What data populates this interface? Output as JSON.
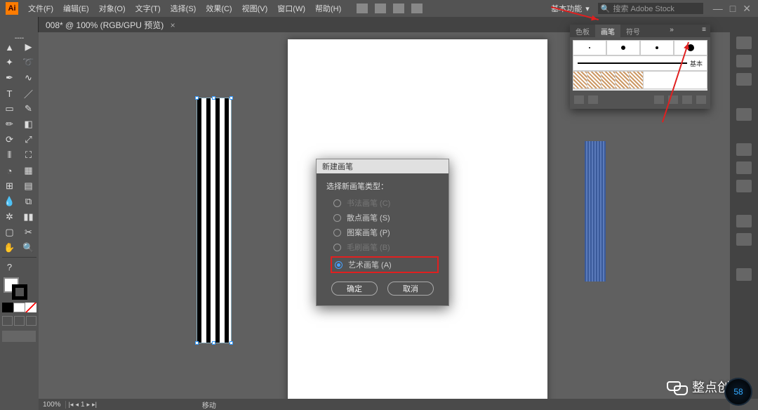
{
  "app": {
    "logo": "Ai"
  },
  "menu": {
    "items": [
      "文件(F)",
      "编辑(E)",
      "对象(O)",
      "文字(T)",
      "选择(S)",
      "效果(C)",
      "视图(V)",
      "窗口(W)",
      "帮助(H)"
    ]
  },
  "workspace": {
    "label": "基本功能",
    "chevron": "▾"
  },
  "search": {
    "placeholder": "搜索 Adobe Stock",
    "icon": "🔍"
  },
  "window_buttons": {
    "min": "—",
    "max": "□",
    "close": "✕"
  },
  "document": {
    "tab_title": "008* @ 100% (RGB/GPU 预览)",
    "close": "×"
  },
  "brush_panel": {
    "tabs": [
      "色板",
      "画笔",
      "符号"
    ],
    "active_tab": 1,
    "basic_label": "基本",
    "menu_glyph": "≡",
    "expand_glyph": "»"
  },
  "dialog": {
    "title": "新建画笔",
    "label": "选择新画笔类型：",
    "options": [
      {
        "label": "书法画笔 (C)",
        "enabled": false,
        "selected": false
      },
      {
        "label": "散点画笔 (S)",
        "enabled": true,
        "selected": false
      },
      {
        "label": "图案画笔 (P)",
        "enabled": true,
        "selected": false
      },
      {
        "label": "毛刷画笔 (B)",
        "enabled": false,
        "selected": false
      },
      {
        "label": "艺术画笔 (A)",
        "enabled": true,
        "selected": true,
        "highlight": true
      }
    ],
    "ok": "确定",
    "cancel": "取消"
  },
  "status": {
    "zoom": "100%",
    "page": "1",
    "tool": "移动"
  },
  "watermark": {
    "text": "整点创作"
  },
  "speedometer": {
    "value": "58"
  },
  "colors": {
    "accent": "#ff7c00",
    "highlight": "#e02020",
    "selection": "#46a0ff"
  },
  "chart_data": null
}
